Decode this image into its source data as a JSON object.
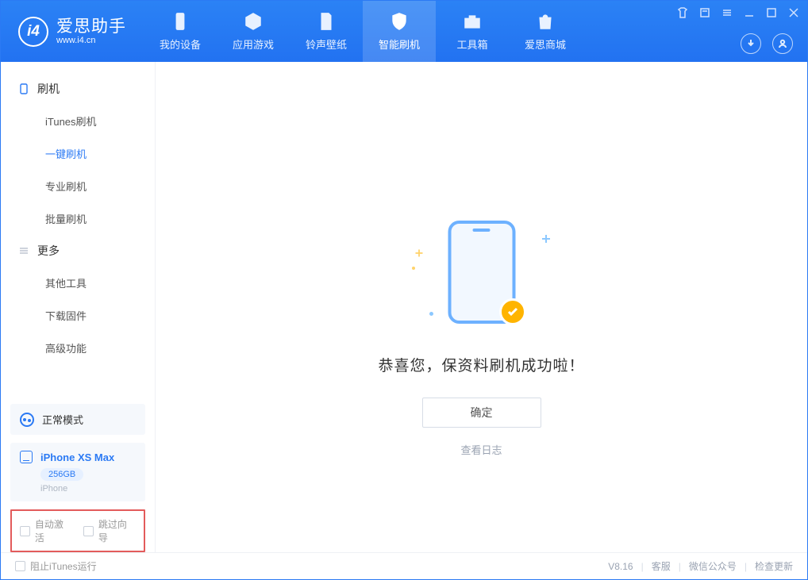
{
  "brand": {
    "title": "爱思助手",
    "sub": "www.i4.cn"
  },
  "tabs": [
    {
      "label": "我的设备"
    },
    {
      "label": "应用游戏"
    },
    {
      "label": "铃声壁纸"
    },
    {
      "label": "智能刷机"
    },
    {
      "label": "工具箱"
    },
    {
      "label": "爱思商城"
    }
  ],
  "sidebar": {
    "group1": {
      "title": "刷机",
      "items": [
        "iTunes刷机",
        "一键刷机",
        "专业刷机",
        "批量刷机"
      ]
    },
    "group2": {
      "title": "更多",
      "items": [
        "其他工具",
        "下载固件",
        "高级功能"
      ]
    }
  },
  "mode": {
    "label": "正常模式"
  },
  "device": {
    "name": "iPhone XS Max",
    "capacity": "256GB",
    "type": "iPhone"
  },
  "options": {
    "opt1": "自动激活",
    "opt2": "跳过向导"
  },
  "main": {
    "success": "恭喜您，保资料刷机成功啦！",
    "ok": "确定",
    "log": "查看日志"
  },
  "status": {
    "block_itunes": "阻止iTunes运行",
    "version": "V8.16",
    "support": "客服",
    "wechat": "微信公众号",
    "update": "检查更新"
  }
}
